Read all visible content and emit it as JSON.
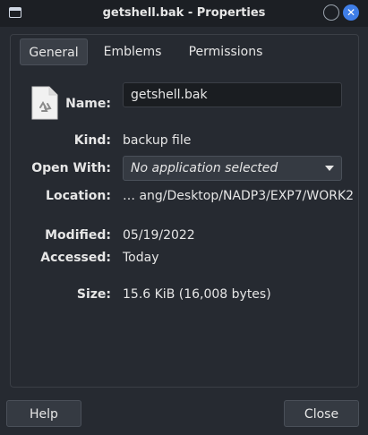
{
  "window": {
    "title": "getshell.bak - Properties"
  },
  "tabs": [
    {
      "label": "General",
      "active": true
    },
    {
      "label": "Emblems",
      "active": false
    },
    {
      "label": "Permissions",
      "active": false
    }
  ],
  "general": {
    "name_label": "Name:",
    "name_value": "getshell.bak",
    "kind_label": "Kind:",
    "kind_value": "backup file",
    "openwith_label": "Open With:",
    "openwith_value": "No application selected",
    "location_label": "Location:",
    "location_value": "… ang/Desktop/NADP3/EXP7/WORK2",
    "modified_label": "Modified:",
    "modified_value": "05/19/2022",
    "accessed_label": "Accessed:",
    "accessed_value": "Today",
    "size_label": "Size:",
    "size_value": "15.6 KiB (16,008 bytes)"
  },
  "buttons": {
    "help": "Help",
    "close": "Close"
  },
  "icons": {
    "title_app": "window-icon",
    "file": "recycle-file-icon",
    "minimize": "minimize-icon",
    "close": "close-icon"
  },
  "colors": {
    "accent": "#3f7ee8",
    "window_bg": "#262a31",
    "titlebar_bg": "#1c1f24"
  }
}
